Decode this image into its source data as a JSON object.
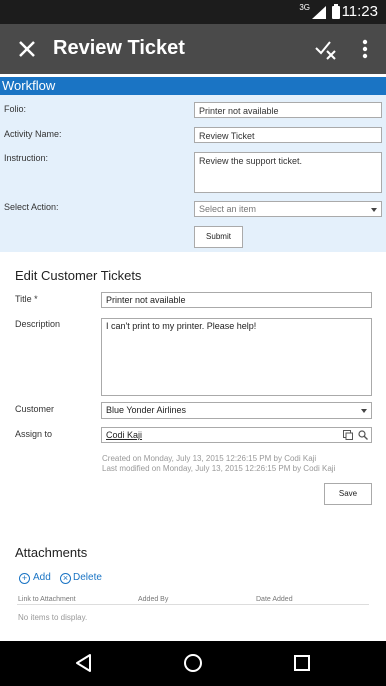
{
  "status_bar": {
    "time": "11:23",
    "network": "3G"
  },
  "app_bar": {
    "title": "Review Ticket"
  },
  "workflow": {
    "header": "Workflow",
    "folio_label": "Folio:",
    "folio_value": "Printer not available",
    "activity_label": "Activity Name:",
    "activity_value": "Review Ticket",
    "instruction_label": "Instruction:",
    "instruction_value": "Review the support ticket.",
    "action_label": "Select Action:",
    "action_placeholder": "Select an item",
    "submit_label": "Submit"
  },
  "edit": {
    "title": "Edit Customer Tickets",
    "title_label": "Title *",
    "title_value": "Printer not available",
    "description_label": "Description",
    "description_value": "I can't print to my printer. Please help!",
    "customer_label": "Customer",
    "customer_value": "Blue Yonder Airlines",
    "assign_label": "Assign to",
    "assign_value": "Codi Kaji",
    "created_on": "Created on  Monday, July 13, 2015 12:26:15 PM  by  Codi Kaji",
    "modified_on": "Last modified on  Monday, July 13, 2015 12:26:15 PM  by  Codi Kaji",
    "save_label": "Save"
  },
  "attachments": {
    "title": "Attachments",
    "add_label": "Add",
    "delete_label": "Delete",
    "columns": [
      "Link to Attachment",
      "Added By",
      "Date Added"
    ],
    "empty_text": "No items to display."
  }
}
